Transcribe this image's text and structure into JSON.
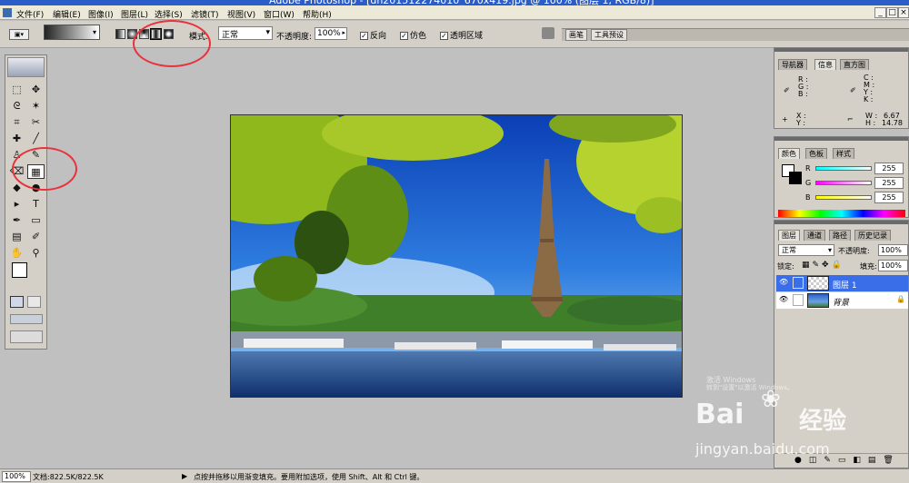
{
  "window": {
    "title": "Adobe Photoshop - [dn201512274010_670x419.jpg @ 100% (图层 1, RGB/8)]",
    "buttons": [
      "_",
      "□",
      "×"
    ]
  },
  "menu": [
    "文件(F)",
    "编辑(E)",
    "图像(I)",
    "图层(L)",
    "选择(S)",
    "滤镜(T)",
    "视图(V)",
    "窗口(W)",
    "帮助(H)"
  ],
  "options": {
    "mode_label": "模式:",
    "mode_value": "正常",
    "opacity_label": "不透明度:",
    "opacity_value": "100%",
    "reverse_label": "反向",
    "dither_label": "仿色",
    "transparency_label": "透明区域",
    "brush_tab": "画笔",
    "presets_tab": "工具预设"
  },
  "toolbox": {
    "tools": [
      "marquee-tool",
      "move-tool",
      "lasso-tool",
      "magic-wand-tool",
      "crop-tool",
      "slice-tool",
      "healing-brush-tool",
      "brush-tool",
      "clone-stamp-tool",
      "history-brush-tool",
      "eraser-tool",
      "gradient-tool",
      "blur-tool",
      "dodge-tool",
      "path-selection-tool",
      "type-tool",
      "pen-tool",
      "shape-tool",
      "notes-tool",
      "eyedropper-tool",
      "hand-tool",
      "zoom-tool"
    ],
    "glyphs": [
      "⬚",
      "✥",
      "ᘓ",
      "✶",
      "⌗",
      "✂",
      "✚",
      "╱",
      "♙",
      "✎",
      "⌫",
      "▦",
      "◆",
      "●",
      "▸",
      "T",
      "✒",
      "▭",
      "▤",
      "✐",
      "✋",
      "⚲"
    ]
  },
  "info_panel": {
    "tabs": [
      "导航器",
      "信息",
      "直方图"
    ],
    "rgb": [
      "R :",
      "G :",
      "B :"
    ],
    "cmyk": [
      "C :",
      "M :",
      "Y :",
      "K :"
    ],
    "xy": [
      "X :",
      "Y :"
    ],
    "wh_labels": [
      "W :",
      "H :"
    ],
    "wh_values": [
      "6.67",
      "14.78"
    ]
  },
  "color_panel": {
    "tabs": [
      "颜色",
      "色板",
      "样式"
    ],
    "channels": [
      {
        "name": "R",
        "value": "255"
      },
      {
        "name": "G",
        "value": "255"
      },
      {
        "name": "B",
        "value": "255"
      }
    ]
  },
  "layers_panel": {
    "tabs": [
      "图层",
      "通道",
      "路径",
      "历史记录"
    ],
    "blend_mode": "正常",
    "opacity_label": "不透明度:",
    "opacity_value": "100%",
    "lock_label": "锁定:",
    "fill_label": "填充:",
    "fill_value": "100%",
    "layers": [
      {
        "name": "图层 1",
        "selected": true
      },
      {
        "name": "背景",
        "selected": false
      }
    ]
  },
  "status": {
    "zoom": "100%",
    "doc_info": "文档:822.5K/822.5K",
    "hint": "点按并拖移以用渐变填充。要用附加选项，使用 Shift、Alt 和 Ctrl 键。"
  },
  "watermark": {
    "brand": "Bai",
    "brand2": "经验",
    "url": "jingyan.baidu.com",
    "windows": "激活 Windows",
    "windows_sub": "转到\"设置\"以激活 Windows。"
  }
}
